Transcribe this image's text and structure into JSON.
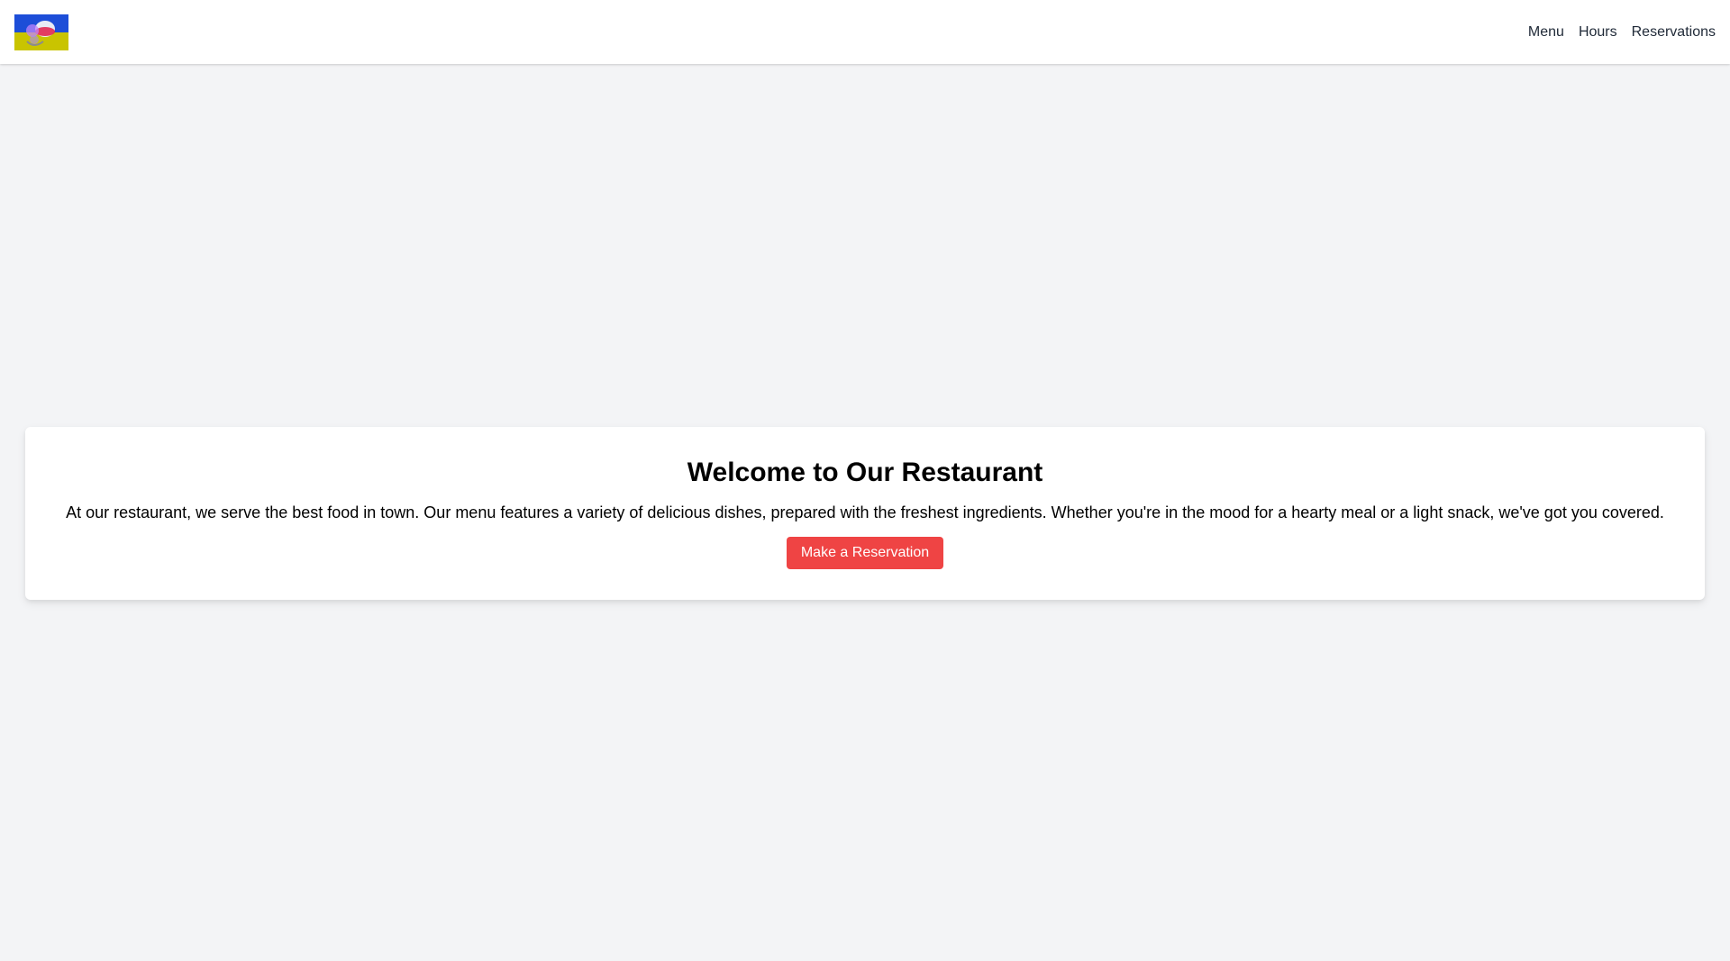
{
  "navbar": {
    "logo": {
      "icon": "restaurant-logo-icon",
      "colors": {
        "top": "#1d4ed8",
        "bottom": "#d4d000"
      }
    },
    "links": [
      {
        "label": "Menu"
      },
      {
        "label": "Hours"
      },
      {
        "label": "Reservations"
      }
    ]
  },
  "hero": {
    "title": "Welcome to Our Restaurant",
    "description": "At our restaurant, we serve the best food in town. Our menu features a variety of delicious dishes, prepared with the freshest ingredients. Whether you're in the mood for a hearty meal or a light snack, we've got you covered.",
    "button_label": "Make a Reservation"
  },
  "colors": {
    "page_background": "#f3f4f6",
    "card_background": "#ffffff",
    "accent": "#ef4444",
    "nav_text": "#1f2937"
  }
}
